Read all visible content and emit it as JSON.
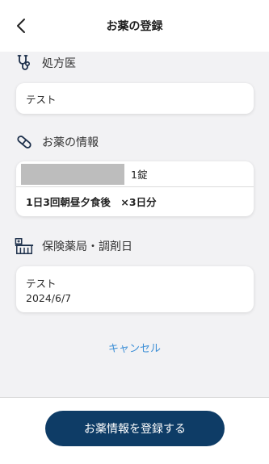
{
  "header": {
    "title": "お薬の登録",
    "back_icon": "chevron-left-icon"
  },
  "sections": {
    "doctor": {
      "label": "処方医",
      "icon": "stethoscope-icon",
      "value": "テスト"
    },
    "medicine": {
      "label": "お薬の情報",
      "icon": "pill-icon",
      "item": {
        "quantity": "1錠",
        "dosage": "1日3回朝昼夕食後　×3日分"
      }
    },
    "pharmacy": {
      "label": "保険薬局・調剤日",
      "icon": "pharmacy-building-icon",
      "name": "テスト",
      "date": "2024/6/7"
    }
  },
  "actions": {
    "cancel_label": "キャンセル",
    "register_label": "お薬情報を登録する"
  },
  "colors": {
    "primary_button": "#0e3c66",
    "link": "#3d8fd6",
    "background": "#f2f2f4"
  }
}
